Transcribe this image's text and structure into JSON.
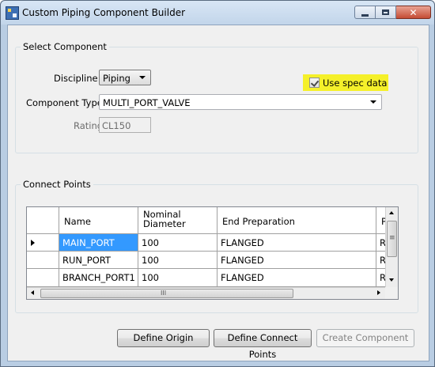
{
  "window": {
    "title": "Custom Piping Component Builder",
    "buttons": {
      "minimize": "minimize-icon",
      "maximize": "maximize-icon",
      "close": "close-icon"
    },
    "close_glyph": "✕"
  },
  "select_component": {
    "legend": "Select Component",
    "discipline_label": "Discipline:",
    "discipline_value": "Piping",
    "component_type_label": "Component Type:",
    "component_type_value": "MULTI_PORT_VALVE",
    "rating_label": "Rating:",
    "rating_value": "CL150",
    "use_spec_label": "Use spec data",
    "use_spec_checked": true,
    "highlight_color": "#f5f02a"
  },
  "connect_points": {
    "legend": "Connect Points",
    "columns": [
      {
        "label": "Name"
      },
      {
        "label": "Nominal\nDiameter"
      },
      {
        "label": "End Preparation"
      },
      {
        "label": "P"
      }
    ],
    "rows": [
      {
        "name": "MAIN_PORT",
        "diameter": "100",
        "end_prep": "FLANGED",
        "p": "R",
        "current": true
      },
      {
        "name": "RUN_PORT",
        "diameter": "100",
        "end_prep": "FLANGED",
        "p": "R",
        "current": false
      },
      {
        "name": "BRANCH_PORT1",
        "diameter": "100",
        "end_prep": "FLANGED",
        "p": "R",
        "current": false
      }
    ],
    "scroll_grip": "III",
    "vscroll_grip": "≡"
  },
  "buttons": {
    "define_origin": "Define Origin",
    "define_connect_points": "Define Connect Points",
    "create_component": "Create Component",
    "create_component_enabled": false
  }
}
